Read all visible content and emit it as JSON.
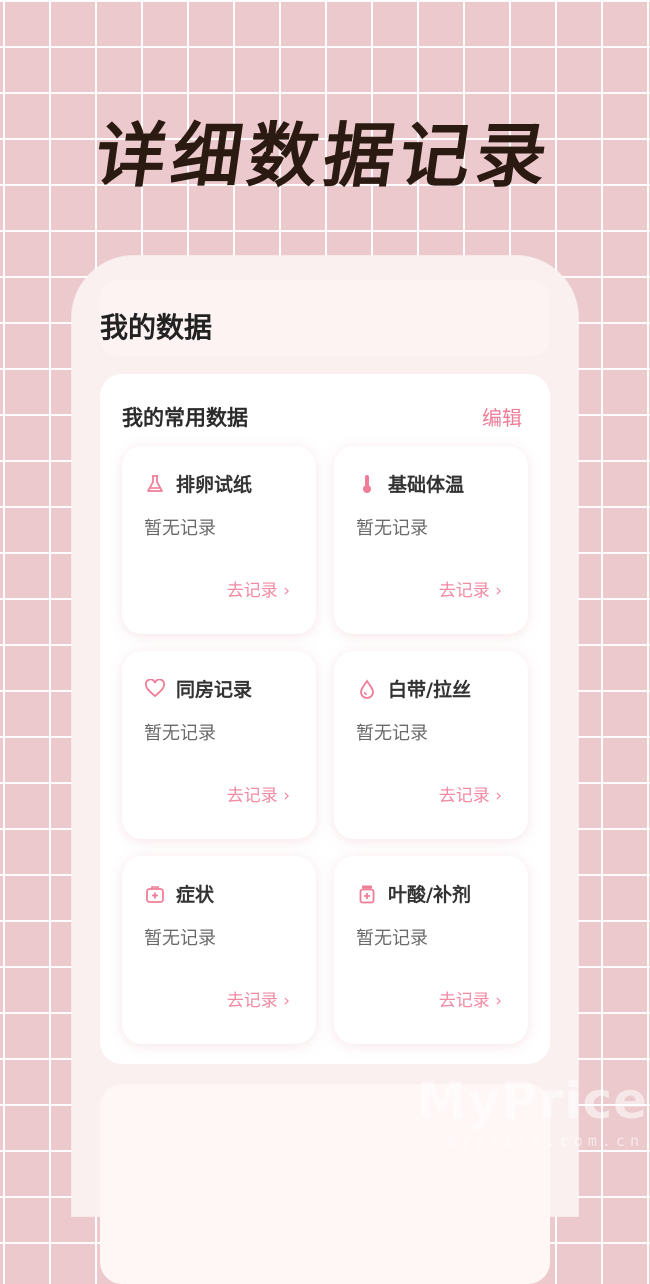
{
  "headline": "详细数据记录",
  "page": {
    "title": "我的数据"
  },
  "section": {
    "title": "我的常用数据",
    "edit_label": "编辑"
  },
  "tiles": [
    {
      "name": "排卵试纸",
      "icon": "flask-icon",
      "status": "暂无记录",
      "link": "去记录 ›"
    },
    {
      "name": "基础体温",
      "icon": "thermometer-icon",
      "status": "暂无记录",
      "link": "去记录 ›"
    },
    {
      "name": "同房记录",
      "icon": "heart-icon",
      "status": "暂无记录",
      "link": "去记录 ›"
    },
    {
      "name": "白带/拉丝",
      "icon": "droplet-icon",
      "status": "暂无记录",
      "link": "去记录 ›"
    },
    {
      "name": "症状",
      "icon": "medical-kit-icon",
      "status": "暂无记录",
      "link": "去记录 ›"
    },
    {
      "name": "叶酸/补剂",
      "icon": "pill-bottle-icon",
      "status": "暂无记录",
      "link": "去记录 ›"
    }
  ],
  "watermark": {
    "brand": "MyPrice",
    "url": "myprice.com.cn"
  },
  "colors": {
    "accent": "#f07d98",
    "background": "#ecc9cd",
    "card": "#ffffff"
  }
}
